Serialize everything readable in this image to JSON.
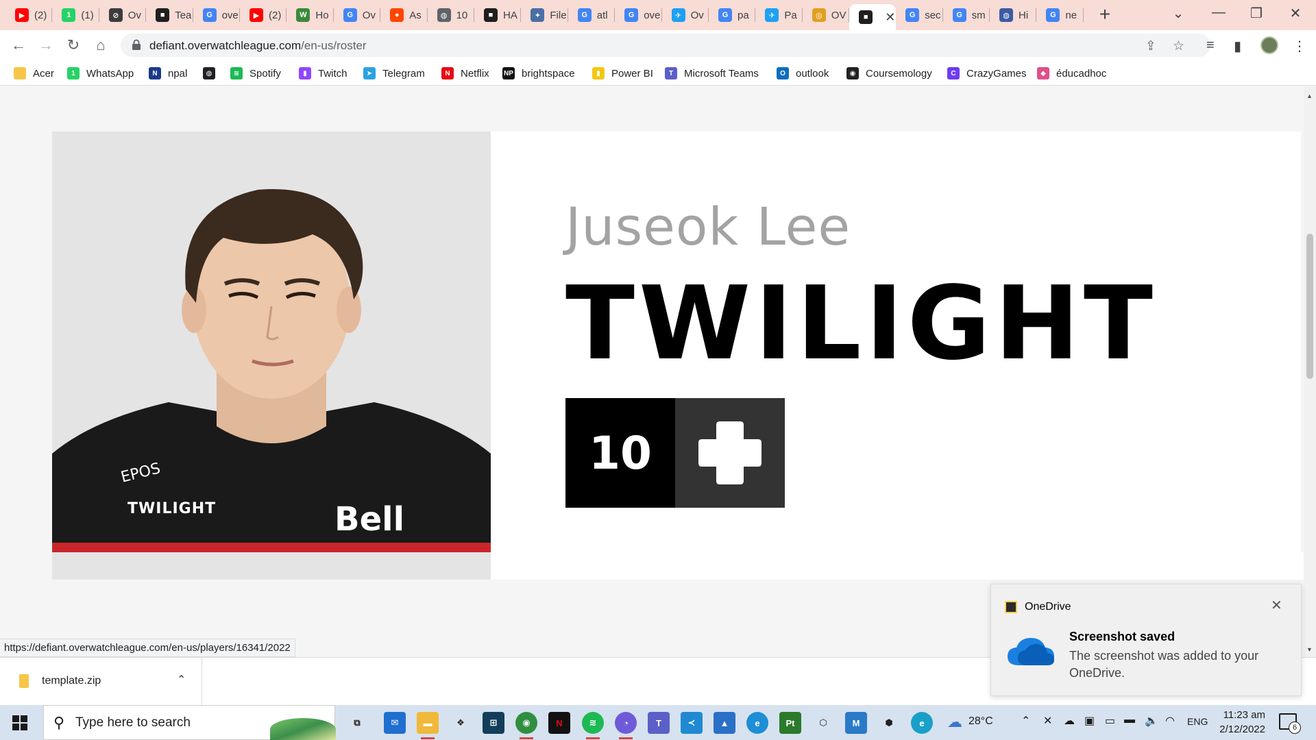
{
  "tabs": [
    {
      "label": "(2)",
      "icon": "youtube-icon",
      "color": "#ff0000",
      "glyph": "▶"
    },
    {
      "label": "(1)",
      "icon": "whatsapp-icon",
      "color": "#25d366",
      "glyph": "1"
    },
    {
      "label": "Ov",
      "icon": "overwatch-icon",
      "color": "#3c3c3c",
      "glyph": "⊘"
    },
    {
      "label": "Tea",
      "icon": "team-logo-icon",
      "color": "#1f1f1f",
      "glyph": "■"
    },
    {
      "label": "ove",
      "icon": "google-icon",
      "color": "#4285f4",
      "glyph": "G"
    },
    {
      "label": "(2)",
      "icon": "youtube-icon",
      "color": "#ff0000",
      "glyph": "▶"
    },
    {
      "label": "Ho",
      "icon": "w-icon",
      "color": "#3a8a3a",
      "glyph": "W"
    },
    {
      "label": "Ov",
      "icon": "google-icon",
      "color": "#4285f4",
      "glyph": "G"
    },
    {
      "label": "As",
      "icon": "reddit-icon",
      "color": "#ff4500",
      "glyph": "●"
    },
    {
      "label": "10",
      "icon": "globe-icon",
      "color": "#5f6368",
      "glyph": "◍"
    },
    {
      "label": "HA",
      "icon": "team-logo-icon",
      "color": "#1f1f1f",
      "glyph": "■"
    },
    {
      "label": "File",
      "icon": "file-icon",
      "color": "#4a6fa5",
      "glyph": "✦"
    },
    {
      "label": "atl",
      "icon": "google-icon",
      "color": "#4285f4",
      "glyph": "G"
    },
    {
      "label": "ove",
      "icon": "google-icon",
      "color": "#4285f4",
      "glyph": "G"
    },
    {
      "label": "Ov",
      "icon": "twitter-icon",
      "color": "#1da1f2",
      "glyph": "✈"
    },
    {
      "label": "pa",
      "icon": "google-icon",
      "color": "#4285f4",
      "glyph": "G"
    },
    {
      "label": "Pa",
      "icon": "twitter-icon",
      "color": "#1da1f2",
      "glyph": "✈"
    },
    {
      "label": "OV",
      "icon": "coin-icon",
      "color": "#e0a020",
      "glyph": "◎"
    },
    {
      "label": "",
      "icon": "team-logo-icon",
      "color": "#1f1f1f",
      "glyph": "■",
      "active": true
    },
    {
      "label": "sec",
      "icon": "google-icon",
      "color": "#4285f4",
      "glyph": "G"
    },
    {
      "label": "sm",
      "icon": "google-icon",
      "color": "#4285f4",
      "glyph": "G"
    },
    {
      "label": "Hi",
      "icon": "globe-icon",
      "color": "#3b5ba5",
      "glyph": "◍"
    },
    {
      "label": "ne",
      "icon": "google-icon",
      "color": "#4285f4",
      "glyph": "G"
    }
  ],
  "omnibox": {
    "host": "defiant.overwatchleague.com",
    "path": "/en-us/roster"
  },
  "bookmarks": [
    {
      "label": "Acer",
      "icon": "folder-icon",
      "color": "#f6c648",
      "glyph": ""
    },
    {
      "label": "WhatsApp",
      "icon": "whatsapp-icon",
      "color": "#25d366",
      "glyph": "1"
    },
    {
      "label": "npal",
      "icon": "npal-icon",
      "color": "#1b3a8c",
      "glyph": "N"
    },
    {
      "label": "",
      "icon": "globe-icon",
      "color": "#202124",
      "glyph": "◍"
    },
    {
      "label": "Spotify",
      "icon": "spotify-icon",
      "color": "#1db954",
      "glyph": "≋"
    },
    {
      "label": "Twitch",
      "icon": "twitch-icon",
      "color": "#9146ff",
      "glyph": "▮"
    },
    {
      "label": "Telegram",
      "icon": "telegram-icon",
      "color": "#2aa3e0",
      "glyph": "➤"
    },
    {
      "label": "Netflix",
      "icon": "netflix-icon",
      "color": "#e50914",
      "glyph": "N"
    },
    {
      "label": "brightspace",
      "icon": "np-icon",
      "color": "#111111",
      "glyph": "NP"
    },
    {
      "label": "Power BI",
      "icon": "powerbi-icon",
      "color": "#f2c811",
      "glyph": "▮"
    },
    {
      "label": "Microsoft Teams",
      "icon": "teams-icon",
      "color": "#5b5fc7",
      "glyph": "T"
    },
    {
      "label": "outlook",
      "icon": "outlook-icon",
      "color": "#0f6cbd",
      "glyph": "O"
    },
    {
      "label": "Coursemology",
      "icon": "coursemology-icon",
      "color": "#222222",
      "glyph": "◉"
    },
    {
      "label": "CrazyGames",
      "icon": "crazygames-icon",
      "color": "#6e3cf0",
      "glyph": "C"
    },
    {
      "label": "éducadhoc",
      "icon": "educadhoc-icon",
      "color": "#e04f8a",
      "glyph": "◆"
    }
  ],
  "player": {
    "real_name": "Juseok Lee",
    "handle": "TWILIGHT",
    "number": "10",
    "role_icon": "support-plus-icon",
    "jersey_sponsor_top": "EPOS",
    "jersey_name": "TWILIGHT",
    "jersey_sponsor": "Bell"
  },
  "status_url": "https://defiant.overwatchleague.com/en-us/players/16341/2022",
  "download": {
    "filename": "template.zip"
  },
  "toast": {
    "app": "OneDrive",
    "title": "Screenshot saved",
    "body": "The screenshot was added to your OneDrive."
  },
  "taskbar": {
    "search_placeholder": "Type here to search",
    "weather": "28°C",
    "language": "ENG",
    "time": "11:23 am",
    "date": "2/12/2022",
    "notification_count": "6"
  }
}
